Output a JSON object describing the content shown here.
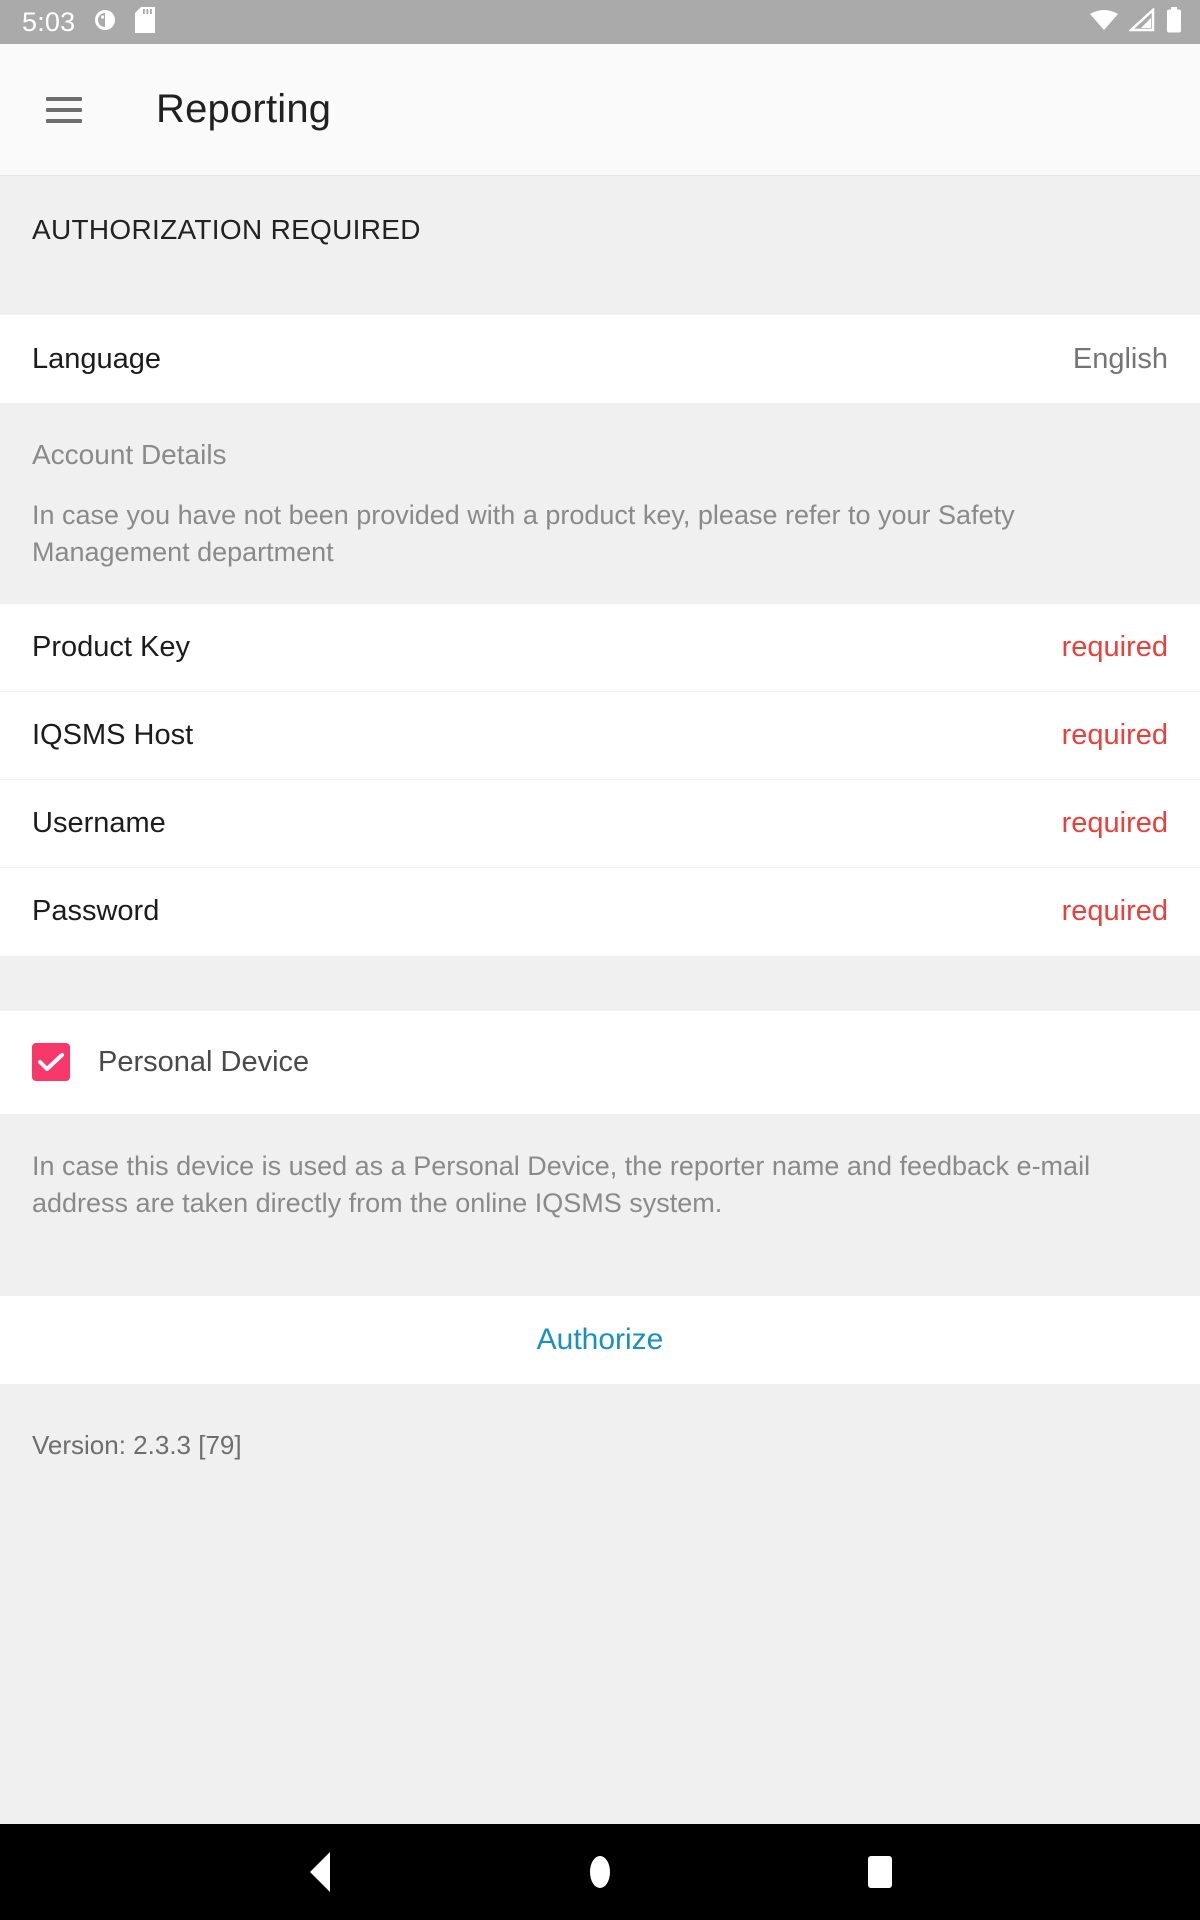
{
  "status_bar": {
    "time": "5:03",
    "left_icons": [
      "alarm-clock-icon",
      "sd-card-icon"
    ],
    "right_icons": [
      "wifi-icon",
      "cellular-signal-icon",
      "battery-icon"
    ]
  },
  "app_bar": {
    "menu_icon": "hamburger-menu-icon",
    "title": "Reporting"
  },
  "section_header": {
    "text": "AUTHORIZATION REQUIRED"
  },
  "language_row": {
    "label": "Language",
    "value": "English"
  },
  "account_details": {
    "title": "Account Details",
    "description": "In case you have not been provided with a product key, please refer to your Safety Management department"
  },
  "fields": [
    {
      "label": "Product Key",
      "value": "required"
    },
    {
      "label": "IQSMS Host",
      "value": "required"
    },
    {
      "label": "Username",
      "value": "required"
    },
    {
      "label": "Password",
      "value": "required"
    }
  ],
  "personal_device": {
    "label": "Personal Device",
    "checked": true,
    "description": "In case this device is used as a Personal Device, the reporter name and feedback e-mail address are taken directly from the online IQSMS system."
  },
  "authorize": {
    "label": "Authorize"
  },
  "version": {
    "text": "Version: 2.3.3 [79]"
  },
  "nav_bar": {
    "back": "back-triangle-icon",
    "home": "home-circle-icon",
    "recents": "recents-square-icon"
  },
  "colors": {
    "accent_pink": "#f8386b",
    "link_blue": "#1a8fc1",
    "required_red": "#e8413c",
    "grey_bg": "#f0f0f0",
    "status_bar_grey": "#aaaaaa"
  }
}
